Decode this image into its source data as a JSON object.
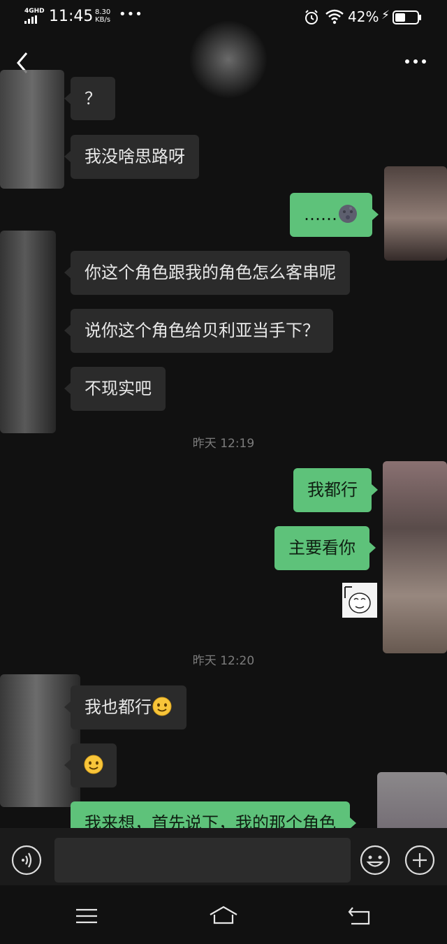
{
  "status_bar": {
    "network": "4GHD",
    "time": "11:45",
    "speed_value": "8.30",
    "speed_unit": "KB/s",
    "overflow": "•••",
    "battery": "42%"
  },
  "messages": [
    {
      "side": "in",
      "text": "？"
    },
    {
      "side": "in",
      "text": "我没啥思路呀"
    },
    {
      "side": "out",
      "text": "……",
      "emoji": "new-moon-face"
    },
    {
      "side": "in",
      "text": "你这个角色跟我的角色怎么客串呢"
    },
    {
      "side": "in",
      "text": "说你这个角色给贝利亚当手下？"
    },
    {
      "side": "in",
      "text": "不现实吧"
    },
    {
      "side": "out",
      "text": "我都行"
    },
    {
      "side": "out",
      "text": "主要看你"
    },
    {
      "side": "in",
      "text": "我也都行",
      "emoji": "smiling-face"
    },
    {
      "side": "in",
      "text": "",
      "emoji": "smiling-face"
    },
    {
      "side": "out",
      "text": "我来想，首先说下，我的那个角色"
    }
  ],
  "timestamps": [
    "昨天 12:19",
    "昨天 12:20"
  ],
  "sticker": {
    "icon": "meme-face-sticker"
  },
  "input_bar": {
    "voice_icon": "voice-icon",
    "emoji_icon": "emoji-icon",
    "plus_icon": "plus-icon"
  },
  "nav_bar": {
    "menu_icon": "menu-icon",
    "home_icon": "home-icon",
    "back_icon": "back-icon"
  },
  "colors": {
    "background": "#111111",
    "incoming_bubble": "#2b2b2b",
    "outgoing_bubble": "#5ec27a",
    "timestamp": "#7c7c7c"
  }
}
